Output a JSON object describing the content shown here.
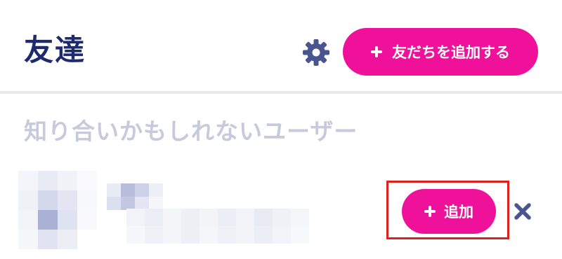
{
  "header": {
    "title": "友達",
    "settings_icon": "gear-icon",
    "add_friend_label": "友だちを追加する"
  },
  "section": {
    "title": "知り合いかもしれないユーザー"
  },
  "suggestion": {
    "avatar_icon": "avatar",
    "add_label": "追加",
    "dismiss_icon": "close-icon"
  },
  "colors": {
    "brand_navy": "#1d2a6e",
    "accent_pink": "#f0119b",
    "muted_heading": "#c7cadc",
    "highlight_red": "#e0201f",
    "icon_slate": "#4a5590"
  }
}
